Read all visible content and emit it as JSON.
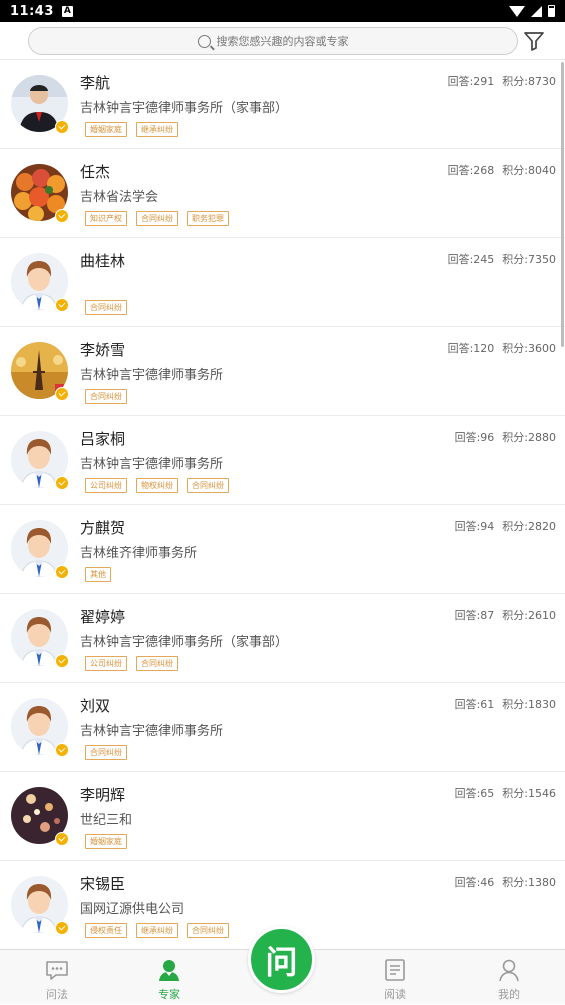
{
  "status": {
    "time": "11:43"
  },
  "search": {
    "placeholder": "搜索您感兴趣的内容或专家"
  },
  "experts": [
    {
      "name": "李航",
      "org": "吉林钟言宇德律师事务所（家事部）",
      "tags": [
        "婚姻家庭",
        "继承纠纷"
      ],
      "answers": "回答:291",
      "points": "积分:8730",
      "avatar": "photo-suit"
    },
    {
      "name": "任杰",
      "org": "吉林省法学会",
      "tags": [
        "知识产权",
        "合同纠纷",
        "职务犯罪"
      ],
      "answers": "回答:268",
      "points": "积分:8040",
      "avatar": "photo-fruit"
    },
    {
      "name": "曲桂林",
      "org": "",
      "tags": [
        "合同纠纷"
      ],
      "answers": "回答:245",
      "points": "积分:7350",
      "avatar": "default-person"
    },
    {
      "name": "李娇雪",
      "org": "吉林钟言宇德律师事务所",
      "tags": [
        "合同纠纷"
      ],
      "answers": "回答:120",
      "points": "积分:3600",
      "avatar": "photo-eiffel"
    },
    {
      "name": "吕家桐",
      "org": "吉林钟言宇德律师事务所",
      "tags": [
        "公司纠纷",
        "物权纠纷",
        "合同纠纷"
      ],
      "answers": "回答:96",
      "points": "积分:2880",
      "avatar": "default-person"
    },
    {
      "name": "方麒贺",
      "org": "吉林维齐律师事务所",
      "tags": [
        "其他"
      ],
      "answers": "回答:94",
      "points": "积分:2820",
      "avatar": "default-person"
    },
    {
      "name": "翟婷婷",
      "org": "吉林钟言宇德律师事务所（家事部）",
      "tags": [
        "公司纠纷",
        "合同纠纷"
      ],
      "answers": "回答:87",
      "points": "积分:2610",
      "avatar": "default-person"
    },
    {
      "name": "刘双",
      "org": "吉林钟言宇德律师事务所",
      "tags": [
        "合同纠纷"
      ],
      "answers": "回答:61",
      "points": "积分:1830",
      "avatar": "default-person"
    },
    {
      "name": "李明辉",
      "org": "世纪三和",
      "tags": [
        "婚姻家庭"
      ],
      "answers": "回答:65",
      "points": "积分:1546",
      "avatar": "photo-lights"
    },
    {
      "name": "宋锡臣",
      "org": "国网辽源供电公司",
      "tags": [
        "侵权责任",
        "继承纠纷",
        "合同纠纷"
      ],
      "answers": "回答:46",
      "points": "积分:1380",
      "avatar": "default-person"
    }
  ],
  "nav": {
    "wenfa": "问法",
    "zhuanjia": "专家",
    "ask": "问",
    "yuedu": "阅读",
    "wode": "我的"
  },
  "colors": {
    "accent": "#27a844",
    "tag": "#d8923a",
    "badge": "#f5b100"
  }
}
